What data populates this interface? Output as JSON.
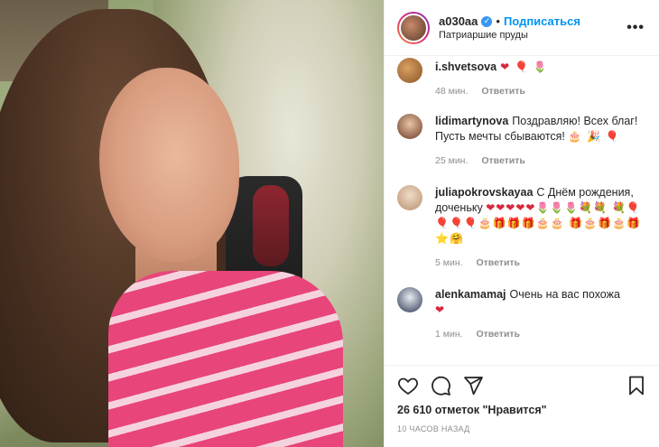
{
  "post": {
    "username": "a030aa",
    "follow_label": "Подписаться",
    "location": "Патриаршие пруды",
    "more_label": "•••"
  },
  "comments": [
    {
      "user": "i.shvetsova",
      "text": "",
      "emoji": "❤ 🎈 🌷",
      "time": "48 мин.",
      "reply": "Ответить",
      "avatar_color": "#b5763e"
    },
    {
      "user": "lidimartynova",
      "text": "Поздравляю! Всех благ! Пусть мечты сбываются!",
      "emoji": "🎂 🎉 🎈",
      "time": "25 мин.",
      "reply": "Ответить",
      "avatar_color": "#8a5a3e"
    },
    {
      "user": "juliapokrovskayaa",
      "text": "С Днём рождения, доченьку",
      "emoji": "❤❤❤❤❤🌷🌷🌷💐💐 💐🎈🎈🎈🎈🎂🎁🎁🎁🎂🎂 🎁🎂🎁🎂🎁⭐🤗",
      "time": "5 мин.",
      "reply": "Ответить",
      "avatar_color": "#d8b89a"
    },
    {
      "user": "alenkamamaj",
      "text": "Очень на вас похожа",
      "emoji": "❤",
      "time": "1 мин.",
      "reply": "Ответить",
      "avatar_color": "#c9cfd8"
    }
  ],
  "footer": {
    "likes": "26 610 отметок \"Нравится\"",
    "time_ago": "10 ЧАСОВ НАЗАД"
  }
}
